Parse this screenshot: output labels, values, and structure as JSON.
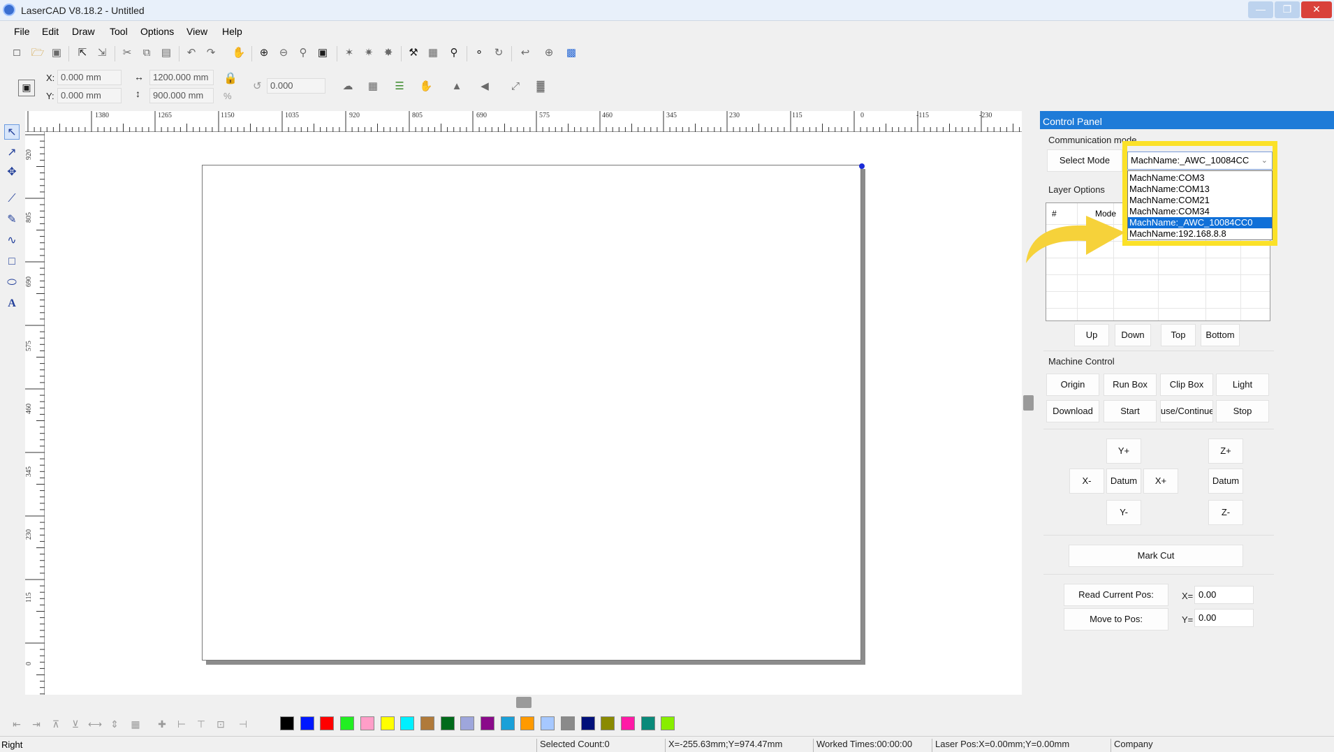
{
  "window": {
    "title": "LaserCAD V8.18.2 - Untitled"
  },
  "menu": [
    "File",
    "Edit",
    "Draw",
    "Tool",
    "Options",
    "View",
    "Help"
  ],
  "position": {
    "x_label": "X:",
    "x_value": "0.000 mm",
    "y_label": "Y:",
    "y_value": "0.000 mm",
    "width_value": "1200.000 mm",
    "height_value": "900.000 mm",
    "percent_label": "%",
    "rotation_value": "0.000"
  },
  "ruler_top": [
    "1380",
    "1265",
    "1150",
    "1035",
    "920",
    "805",
    "690",
    "575",
    "460",
    "345",
    "230",
    "115",
    "0",
    "-115",
    "-230"
  ],
  "ruler_left": [
    "920",
    "805",
    "690",
    "575",
    "460",
    "345",
    "230",
    "115",
    "0"
  ],
  "palette_colors": [
    "#000000",
    "#0018ff",
    "#ff0000",
    "#22ee22",
    "#ff9ec8",
    "#ffff00",
    "#00f0ff",
    "#b07a3a",
    "#006b1b",
    "#9ea6dc",
    "#8a0a8a",
    "#1aa0d8",
    "#ff9a00",
    "#a6c8ff",
    "#8a8a8a",
    "#00107a",
    "#8a8a00",
    "#ff1aa6",
    "#0a8a7a",
    "#88ee00"
  ],
  "status": {
    "left_text": "Right",
    "selected": "Selected Count:0",
    "cursor": "X=-255.63mm;Y=974.47mm",
    "worked": "Worked Times:00:00:00",
    "laser_pos": "Laser Pos:X=0.00mm;Y=0.00mm",
    "company": "Company"
  },
  "control_panel": {
    "title": "Control Panel",
    "communication": {
      "label": "Communication mode",
      "select_mode": "Select Mode",
      "selected": "MachName:_AWC_10084CC",
      "options": [
        "MachName:COM3",
        "MachName:COM13",
        "MachName:COM21",
        "MachName:COM34",
        "MachName:_AWC_10084CC0",
        "MachName:192.168.8.8"
      ],
      "selected_index": 4
    },
    "layer": {
      "label": "Layer Options",
      "col_num": "#",
      "col_mode": "Mode",
      "buttons": [
        "Up",
        "Down",
        "Top",
        "Bottom"
      ]
    },
    "machine": {
      "label": "Machine Control",
      "row1": [
        "Origin",
        "Run Box",
        "Clip Box",
        "Light"
      ],
      "row2": [
        "Download",
        "Start",
        "Pause/Continue",
        "Stop"
      ],
      "y_plus": "Y+",
      "y_minus": "Y-",
      "x_minus": "X-",
      "x_plus": "X+",
      "datum": "Datum",
      "z_plus": "Z+",
      "z_minus": "Z-",
      "z_datum": "Datum",
      "mark_cut": "Mark Cut",
      "read_pos": "Read Current Pos:",
      "move_pos": "Move to Pos:",
      "x_label": "X=",
      "x_val": "0.00",
      "y_label": "Y=",
      "y_val": "0.00"
    }
  },
  "annotation": {
    "highlight_color": "#fbe128",
    "arrow_color": "#f6d23a"
  },
  "icons": {
    "toolbar": [
      "new-file-icon",
      "open-folder-icon",
      "save-icon",
      "import-icon",
      "export-icon",
      "cut-icon",
      "copy-icon",
      "paste-icon",
      "undo-icon",
      "redo-icon",
      "pan-hand-icon",
      "zoom-in-icon",
      "zoom-out-icon",
      "zoom-window-icon",
      "zoom-page-icon",
      "node-edit-icon",
      "join-icon",
      "break-icon",
      "settings-wand-icon",
      "array-icon",
      "search-zoom-icon",
      "cut-lead-icon",
      "direction-icon",
      "simulate-icon",
      "target-icon",
      "monitor-icon"
    ]
  }
}
